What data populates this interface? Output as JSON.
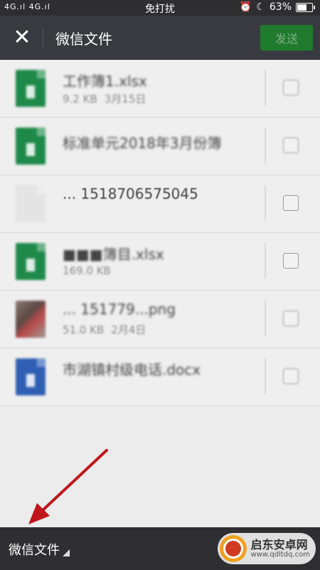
{
  "status_bar": {
    "signal": "4G.ıl 4G.ıl",
    "mode_text": "免打扰",
    "battery_text": "63%",
    "battery_level": 0.63
  },
  "header": {
    "close_glyph": "✕",
    "title": "微信文件",
    "send_label": "发送"
  },
  "files": [
    {
      "name": "工作簿1.xlsx",
      "size": "9.2 KB",
      "date": "3月15日",
      "type": "excel"
    },
    {
      "name": "标准单元2018年3月份簿",
      "size": "",
      "date": "",
      "type": "excel"
    },
    {
      "name": "... 1518706575045",
      "size": "",
      "date": "",
      "type": "blank"
    },
    {
      "name": "■■■簿目.xlsx",
      "size": "169.0 KB",
      "date": "",
      "type": "excel"
    },
    {
      "name": "... 151779...png",
      "size": "51.0 KB",
      "date": "2月4日",
      "type": "image"
    },
    {
      "name": "市湖镇村级电话.docx",
      "size": "",
      "date": "",
      "type": "word"
    }
  ],
  "bottom_bar": {
    "source_label": "微信文件"
  },
  "watermark": {
    "title": "启东安卓网",
    "url": "www.qdltdq.com"
  },
  "colors": {
    "header_bg": "#393a3f",
    "send_button_bg": "#1f7a2e",
    "annotation_arrow": "#c0151b"
  }
}
